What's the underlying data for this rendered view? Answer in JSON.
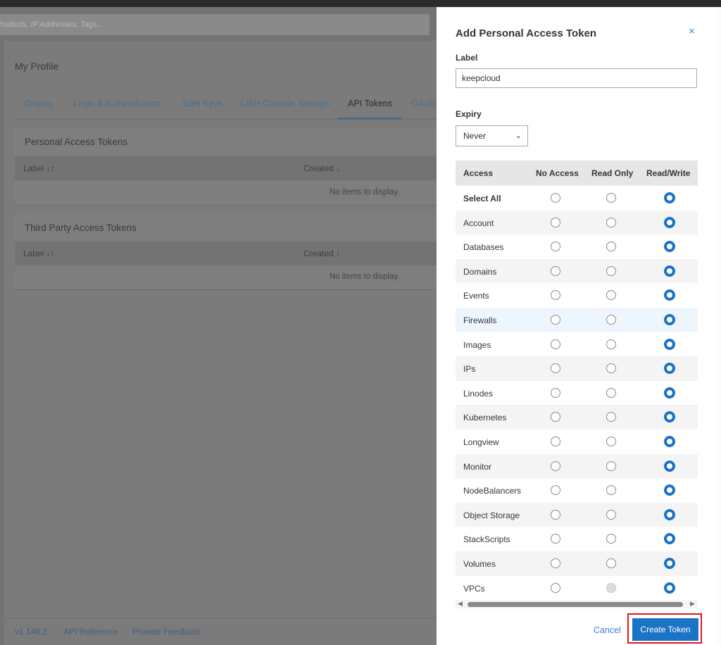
{
  "search": {
    "placeholder": "Products, IP Addresses, Tags..."
  },
  "profile": {
    "title": "My Profile",
    "tabs": [
      "Display",
      "Login & Authentication",
      "SSH Keys",
      "LISH Console Settings",
      "API Tokens",
      "OAuth"
    ],
    "active_tab": "API Tokens"
  },
  "personal": {
    "title": "Personal Access Tokens",
    "col_label": "Label ↓↑",
    "col_created": "Created ↓",
    "empty": "No items to display."
  },
  "third_party": {
    "title": "Third Party Access Tokens",
    "col_label": "Label ↓↑",
    "col_created": "Created ↓",
    "empty": "No items to display."
  },
  "footer": {
    "version": "v1.146.2",
    "api_reference": "API Reference",
    "feedback": "Provide Feedback"
  },
  "drawer": {
    "title": "Add Personal Access Token",
    "close": "×",
    "label_title": "Label",
    "label_value": "keepcloud",
    "expiry_title": "Expiry",
    "expiry_value": "Never",
    "headers": [
      "Access",
      "No Access",
      "Read Only",
      "Read/Write"
    ],
    "rows": [
      {
        "name": "Select All",
        "bold": true
      },
      {
        "name": "Account"
      },
      {
        "name": "Databases"
      },
      {
        "name": "Domains"
      },
      {
        "name": "Events"
      },
      {
        "name": "Firewalls"
      },
      {
        "name": "Images"
      },
      {
        "name": "IPs"
      },
      {
        "name": "Linodes"
      },
      {
        "name": "Kubernetes"
      },
      {
        "name": "Longview"
      },
      {
        "name": "Monitor"
      },
      {
        "name": "NodeBalancers"
      },
      {
        "name": "Object Storage"
      },
      {
        "name": "StackScripts"
      },
      {
        "name": "Volumes"
      },
      {
        "name": "VPCs"
      }
    ],
    "selected": "Read/Write",
    "cancel": "Cancel",
    "create": "Create Token"
  },
  "colors": {
    "accent": "#1b73c6",
    "highlight": "#e0161b"
  }
}
